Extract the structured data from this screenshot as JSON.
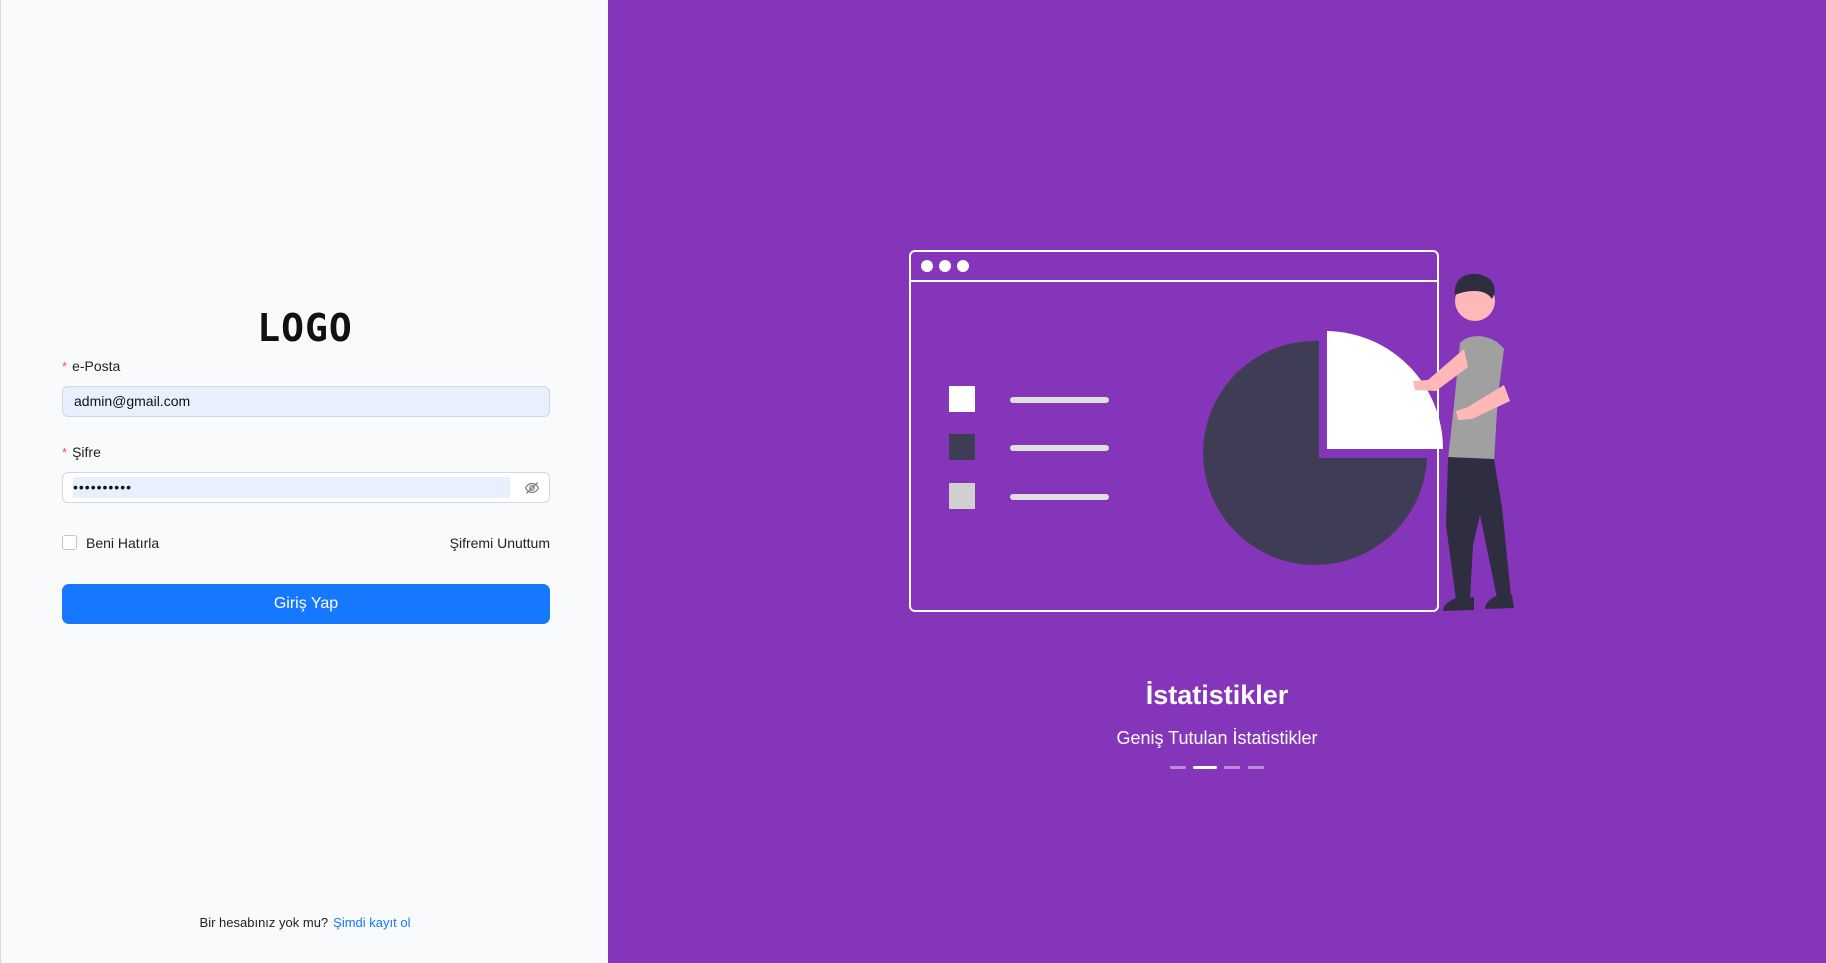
{
  "login": {
    "logo": "LOGO",
    "email_label": "e-Posta",
    "email_value": "admin@gmail.com",
    "password_label": "Şifre",
    "password_value": "••••••••••",
    "required_mark": "*",
    "remember_label": "Beni Hatırla",
    "forgot_label": "Şifremi Unuttum",
    "submit_label": "Giriş Yap",
    "signup_prompt": "Bir hesabınız yok mu?",
    "signup_link": "Şimdi kayıt ol"
  },
  "carousel": {
    "title": "İstatistikler",
    "subtitle": "Geniş Tutulan İstatistikler",
    "slide_count": 4,
    "active_index": 1
  },
  "colors": {
    "panel_bg": "#8535b9",
    "primary": "#1677ff",
    "left_bg": "#f8fafc"
  },
  "icons": [
    "eye-off-icon"
  ]
}
